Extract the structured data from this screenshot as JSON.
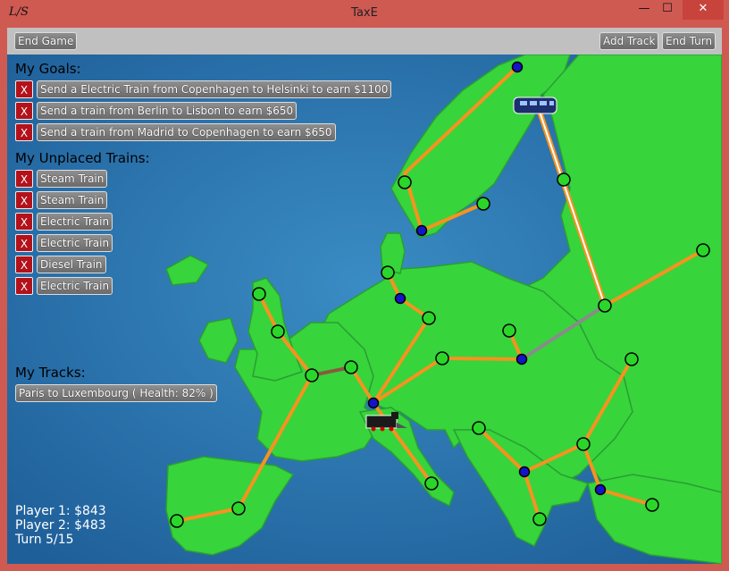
{
  "window": {
    "title": "TaxE",
    "app_icon": "L/S",
    "min": "—",
    "max": "☐",
    "close": "✕"
  },
  "toolbar": {
    "end_game": "End Game",
    "add_track": "Add Track",
    "end_turn": "End Turn"
  },
  "goals": {
    "header": "My Goals:",
    "items": [
      "Send a Electric Train from Copenhagen to Helsinki to earn $1100",
      "Send a train from Berlin to Lisbon to earn $650",
      "Send a train from Madrid to Copenhagen to earn $650"
    ]
  },
  "trains": {
    "header": "My Unplaced Trains:",
    "items": [
      "Steam Train",
      "Steam Train",
      "Electric Train",
      "Electric Train",
      "Diesel Train",
      "Electric Train"
    ]
  },
  "tracks": {
    "header": "My Tracks:",
    "items": [
      "Paris to Luxembourg ( Health: 82% )"
    ]
  },
  "remove_label": "X",
  "status": {
    "player1": "Player 1: $843",
    "player2": "Player 2: $483",
    "turn": "Turn 5/15"
  },
  "colors": {
    "route": "#f5931f",
    "station": "#2ad62a",
    "junction": "#1414c8",
    "land": "#37d43c",
    "sea": "#2f79b0"
  }
}
